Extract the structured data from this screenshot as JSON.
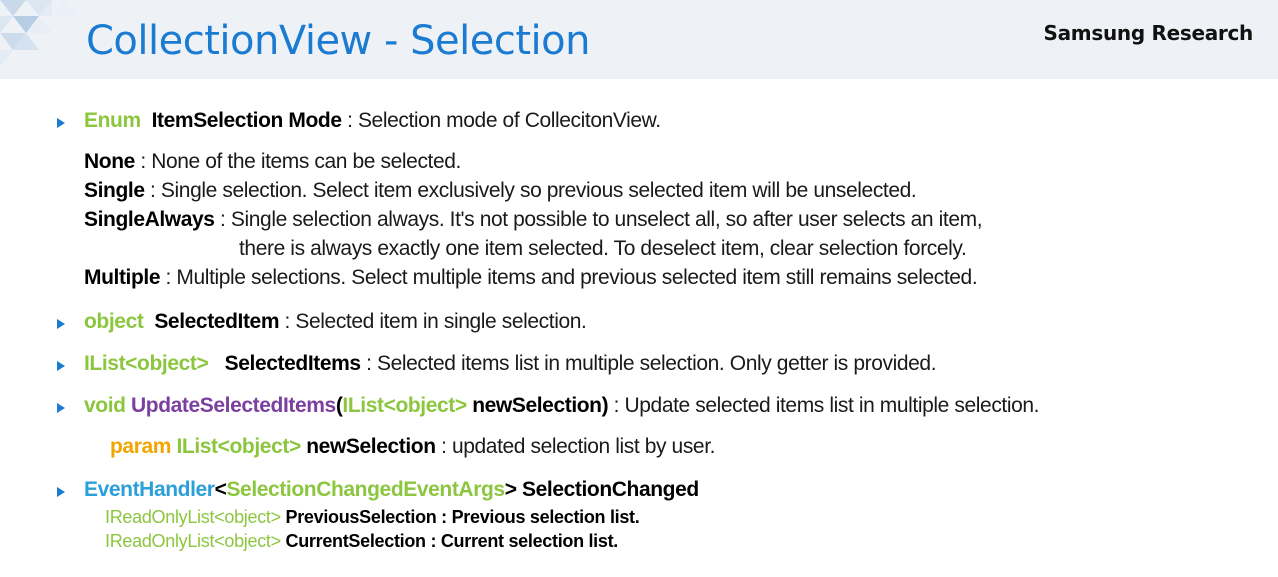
{
  "header": {
    "title": "CollectionView - Selection",
    "brand": "Samsung Research"
  },
  "items": {
    "mode": {
      "type": "Enum",
      "name": "ItemSelection Mode",
      "sep": " : ",
      "desc": "Selection mode of CollecitonView."
    },
    "enum_values": {
      "none_name": "None",
      "none_desc": " : None of the items can be selected.",
      "single_name": "Single",
      "single_desc": " : Single selection. Select item exclusively so previous selected item will be unselected.",
      "single_always_name": "SingleAlways",
      "single_always_desc": " : Single selection always. It's not possible to unselect all, so after user selects an item,",
      "single_always_desc2": "there is always exactly one item selected. To deselect item, clear selection forcely.",
      "multiple_name": "Multiple",
      "multiple_desc": " : Multiple selections. Select multiple items and previous selected item still remains selected."
    },
    "selected_item": {
      "type": "object",
      "name": "SelectedItem",
      "desc": " : Selected item in single selection."
    },
    "selected_items": {
      "type": "IList<object>",
      "name": "SelectedItems",
      "desc": " : Selected items list in multiple selection. Only getter is provided."
    },
    "update_method": {
      "ret": "void",
      "name": "UpdateSelectedItems",
      "open": "(",
      "param_type": "IList<object>",
      "param_name": " newSelection)",
      "desc": " : Update selected items list in multiple selection."
    },
    "param": {
      "keyword": "param",
      "type": " IList<object>",
      "name": " newSelection",
      "desc": " : updated selection list by user."
    },
    "event": {
      "type": "EventHandler",
      "lt": "<",
      "arg_type": "SelectionChangedEventArgs",
      "gt": ">",
      "name": " SelectionChanged",
      "prev_type": "IReadOnlyList<object>",
      "prev_name": " PreviousSelection",
      "prev_desc": " : Previous selection list.",
      "curr_type": "IReadOnlyList<object>",
      "curr_name": " CurrentSelection",
      "curr_desc": " : Current selection list."
    }
  },
  "colors": {
    "title_blue": "#1a7bd1",
    "type_green": "#8cc63f",
    "method_purple": "#7b3fa0",
    "param_orange": "#f0a500",
    "event_blue": "#2b9fd9"
  }
}
